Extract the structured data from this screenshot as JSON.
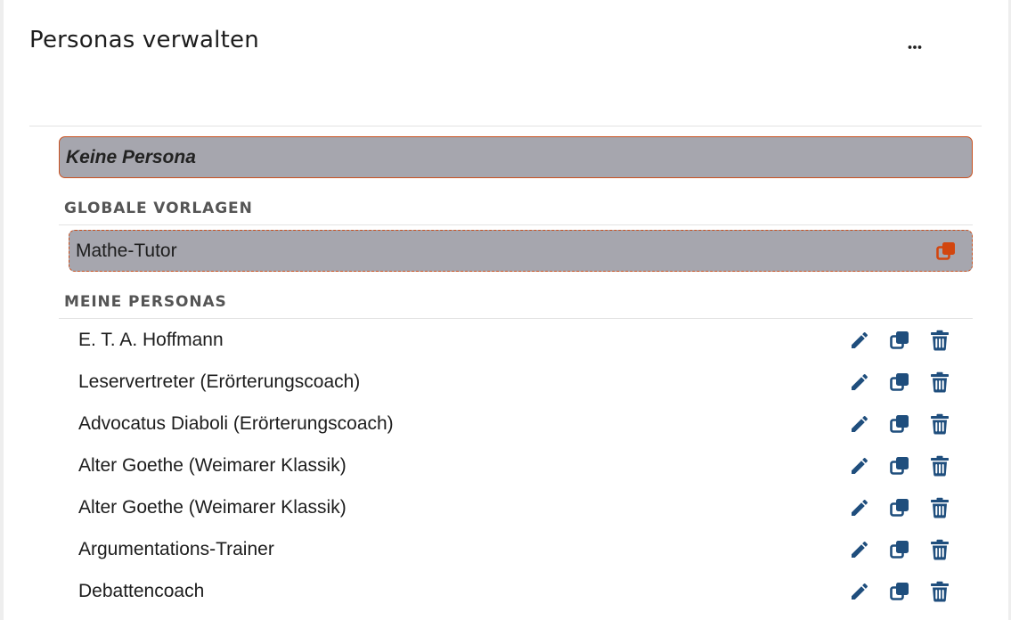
{
  "header": {
    "title": "Personas verwalten",
    "more_icon": "ellipsis-icon"
  },
  "no_persona": {
    "label": "Keine Persona"
  },
  "global_templates": {
    "heading": "GLOBALE VORLAGEN",
    "items": [
      {
        "label": "Mathe-Tutor",
        "action_icon": "copy-icon"
      }
    ]
  },
  "my_personas": {
    "heading": "MEINE PERSONAS",
    "action_icons": [
      "pencil-icon",
      "copy-icon",
      "trash-icon"
    ],
    "items": [
      {
        "label": "E. T. A. Hoffmann"
      },
      {
        "label": "Leservertreter (Erörterungscoach)"
      },
      {
        "label": "Advocatus Diaboli (Erörterungscoach)"
      },
      {
        "label": "Alter Goethe (Weimarer Klassik)"
      },
      {
        "label": "Alter Goethe (Weimarer Klassik)"
      },
      {
        "label": "Argumentations-Trainer"
      },
      {
        "label": "Debattencoach"
      }
    ]
  },
  "colors": {
    "icon_blue": "#1f4e7d",
    "accent_orange": "#d2460f",
    "selected_bg": "#a6a6ae"
  }
}
